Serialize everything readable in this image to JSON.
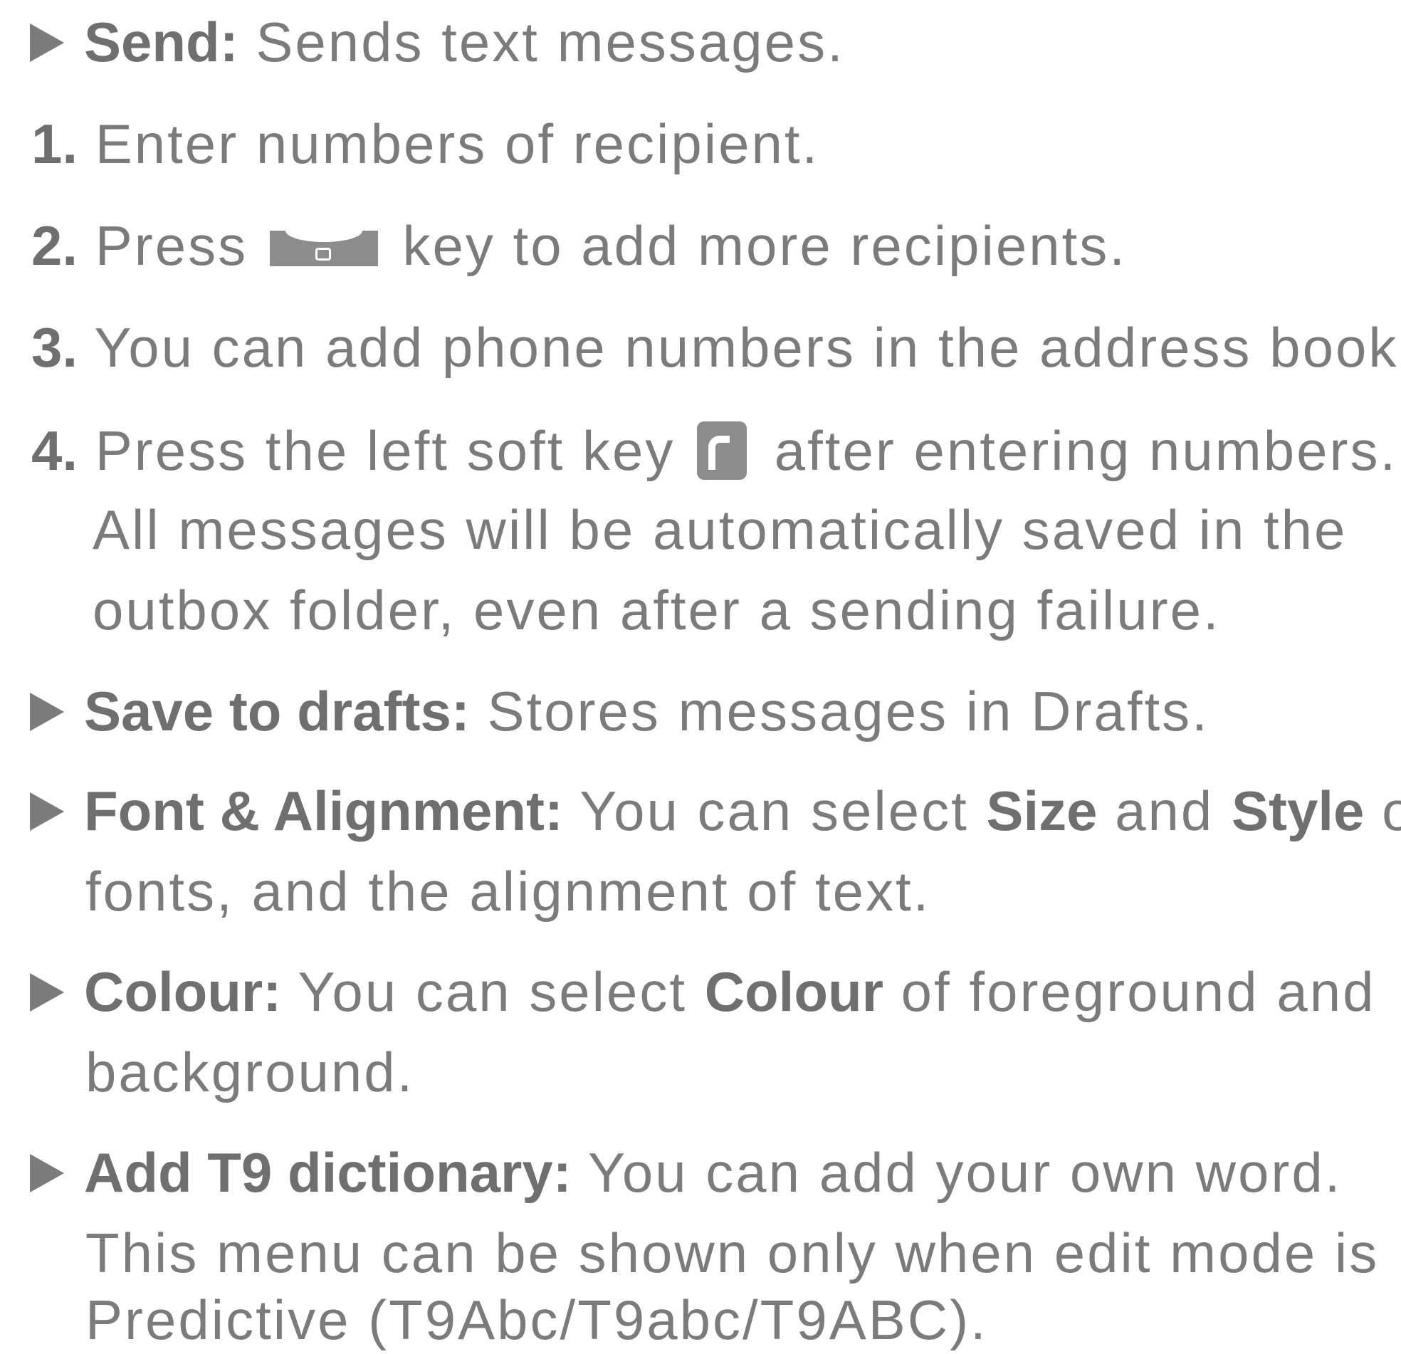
{
  "send": {
    "term": "Send:",
    "desc": "Sends text messages.",
    "steps": [
      {
        "num": "1.",
        "text": "Enter numbers of recipient."
      },
      {
        "num": "2.",
        "text_before": "Press",
        "icon": "send-end-key-icon",
        "text_after": "key to add more recipients."
      },
      {
        "num": "3.",
        "text": "You can add phone numbers in the address book."
      },
      {
        "num": "4.",
        "text_before": "Press the left soft key",
        "icon": "left-soft-key-icon",
        "text_after": "after entering numbers."
      }
    ],
    "step4_cont": [
      "All messages will be automatically saved in the",
      "outbox folder, even after a sending failure."
    ]
  },
  "drafts": {
    "term": "Save to drafts:",
    "desc": "Stores messages in Drafts."
  },
  "font": {
    "term": "Font & Alignment:",
    "desc1": "You can select",
    "bold1": "Size",
    "desc2": "and",
    "bold2": "Style",
    "desc3": "of",
    "line2": "fonts, and the alignment of text."
  },
  "colour": {
    "term": "Colour:",
    "desc1": "You can select",
    "bold1": "Colour",
    "desc2": "of foreground and",
    "line2": "background."
  },
  "t9": {
    "term": "Add T9 dictionary:",
    "desc": "You can add your own word.",
    "line2": "This menu can be shown only when edit mode is",
    "line3": "Predictive (T9Abc/T9abc/T9ABC)."
  },
  "colors": {
    "text": "#7b7b7b",
    "bold_text": "#6f6f6f",
    "key_fill": "#8c8c8c"
  }
}
